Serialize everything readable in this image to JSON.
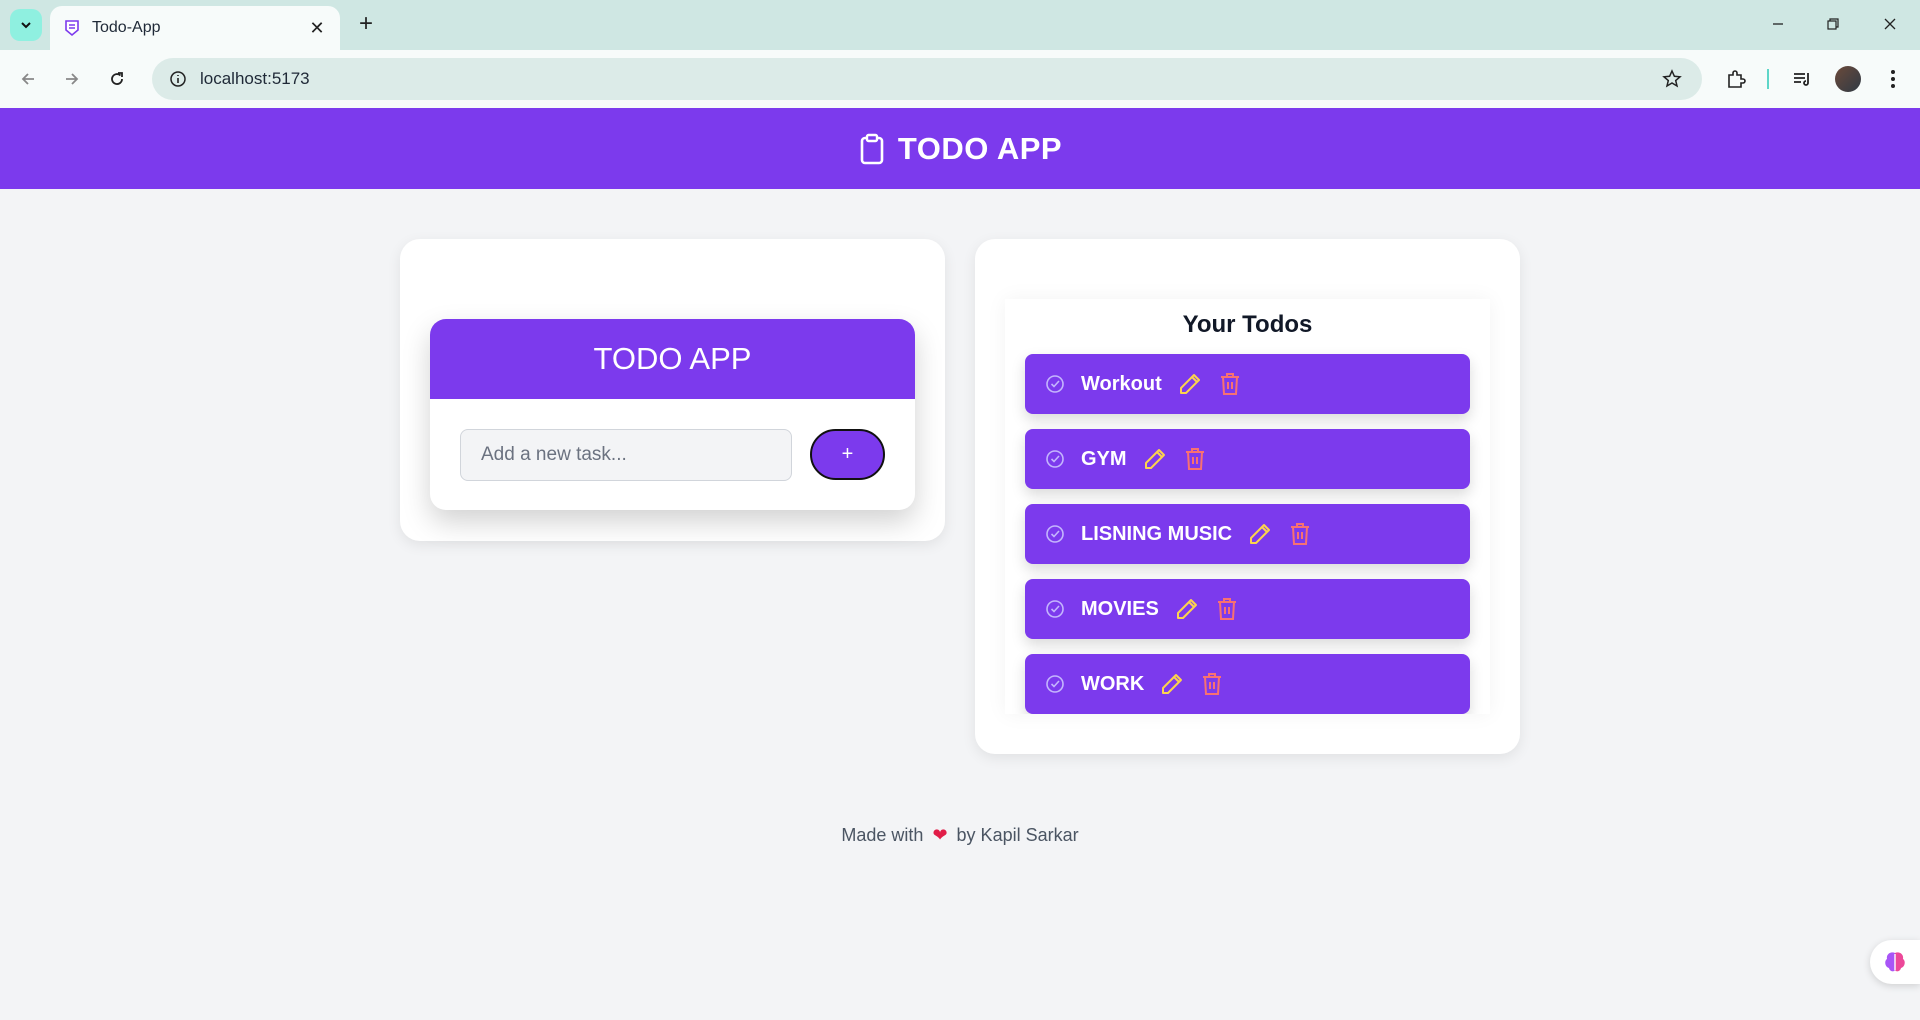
{
  "browser": {
    "tab_title": "Todo-App",
    "url": "localhost:5173"
  },
  "app": {
    "header_title": "TODO APP",
    "form_title": "TODO APP",
    "input_placeholder": "Add a new task...",
    "add_button_label": "+",
    "todos_heading": "Your Todos",
    "todos": [
      {
        "label": "Workout"
      },
      {
        "label": "GYM"
      },
      {
        "label": "LISNING MUSIC"
      },
      {
        "label": "MOVIES"
      },
      {
        "label": "WORK"
      }
    ],
    "footer": {
      "prefix": "Made with",
      "heart": "❤",
      "suffix": "by Kapil Sarkar"
    }
  },
  "colors": {
    "accent": "#7c3aed",
    "edit_icon": "#fcd34d",
    "delete_icon": "#f87171"
  },
  "icons": [
    "chevron-down-icon",
    "tab-favicon-icon",
    "close-icon",
    "plus-icon",
    "minimize-icon",
    "restore-icon",
    "back-icon",
    "forward-icon",
    "reload-icon",
    "info-icon",
    "star-icon",
    "extensions-icon",
    "media-icon",
    "menu-dots-icon",
    "clipboard-icon",
    "check-circle-icon",
    "pencil-icon",
    "trash-icon",
    "brain-icon"
  ]
}
